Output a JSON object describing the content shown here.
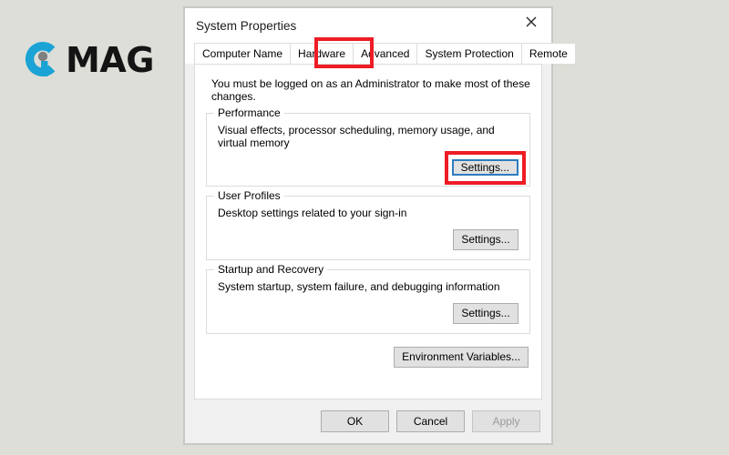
{
  "brand": {
    "name": "logo-c-mark",
    "wordmark": "MAG",
    "mark_color": "#1ba3d6",
    "dot_color": "#808080"
  },
  "dialog": {
    "title": "System Properties",
    "close_icon": "close-icon",
    "tabs": [
      {
        "label": "Computer Name",
        "selected": false
      },
      {
        "label": "Hardware",
        "selected": false
      },
      {
        "label": "Advanced",
        "selected": true
      },
      {
        "label": "System Protection",
        "selected": false
      },
      {
        "label": "Remote",
        "selected": false
      }
    ],
    "highlight_color": "#ee1c25",
    "focus_color": "#2e7dbf",
    "admin_note": "You must be logged on as an Administrator to make most of these changes.",
    "groups": [
      {
        "legend": "Performance",
        "description": "Visual effects, processor scheduling, memory usage, and virtual memory",
        "button_label": "Settings...",
        "button_focused": true,
        "button_highlighted": true
      },
      {
        "legend": "User Profiles",
        "description": "Desktop settings related to your sign-in",
        "button_label": "Settings...",
        "button_focused": false,
        "button_highlighted": false
      },
      {
        "legend": "Startup and Recovery",
        "description": "System startup, system failure, and debugging information",
        "button_label": "Settings...",
        "button_focused": false,
        "button_highlighted": false
      }
    ],
    "environment_variables_label": "Environment Variables...",
    "footer": {
      "ok_label": "OK",
      "cancel_label": "Cancel",
      "apply_label": "Apply",
      "apply_disabled": true
    }
  }
}
